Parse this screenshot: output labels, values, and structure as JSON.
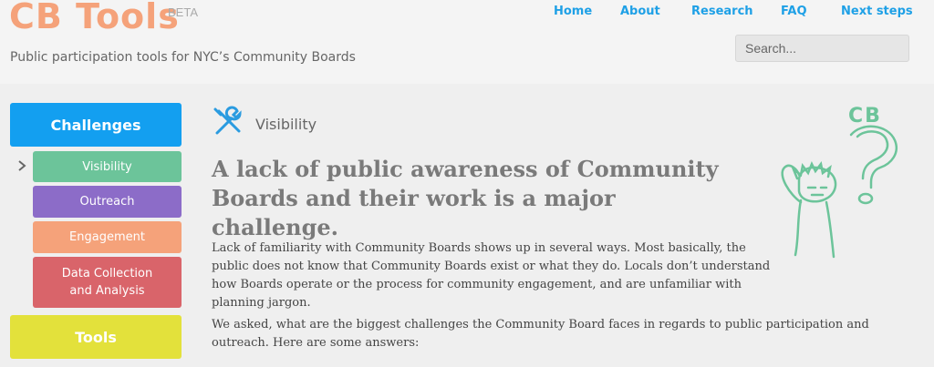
{
  "site": {
    "logo": "CB Tools",
    "beta": "BETA",
    "tagline": "Public participation tools for NYC’s Community Boards"
  },
  "nav": {
    "items": [
      {
        "label": "Home"
      },
      {
        "label": "About"
      },
      {
        "label": "Research"
      },
      {
        "label": "FAQ"
      },
      {
        "label": "Next steps"
      }
    ]
  },
  "search": {
    "placeholder": "Search..."
  },
  "sidebar": {
    "challenges_label": "Challenges",
    "items": [
      {
        "label": "Visibility",
        "color": "#6cc49a",
        "active": true
      },
      {
        "label": "Outreach",
        "color": "#8c6cc8"
      },
      {
        "label": "Engagement",
        "color": "#f5a27a"
      },
      {
        "label": "Data Collection and Analysis",
        "color": "#d9646a"
      }
    ],
    "tools_label": "Tools",
    "colors": {
      "challenges": "#139ff0",
      "tools": "#e3e13b"
    }
  },
  "main": {
    "section_title": "Visibility",
    "section_icon": "wrench-screwdriver-icon",
    "headline": "A lack of public awareness of Community Boards and their work is a major challenge.",
    "paragraphs": [
      "Lack of familiarity with Community Boards shows up in several ways. Most basically, the public does not know that Community Boards exist or what they do. Locals don’t understand how Boards operate or the process for community engagement, and are unfamiliar with planning jargon.",
      "We asked, what are the biggest challenges the Community Board faces in regards to public participation and outreach. Here are some answers:"
    ],
    "doodle_text": "CB"
  }
}
